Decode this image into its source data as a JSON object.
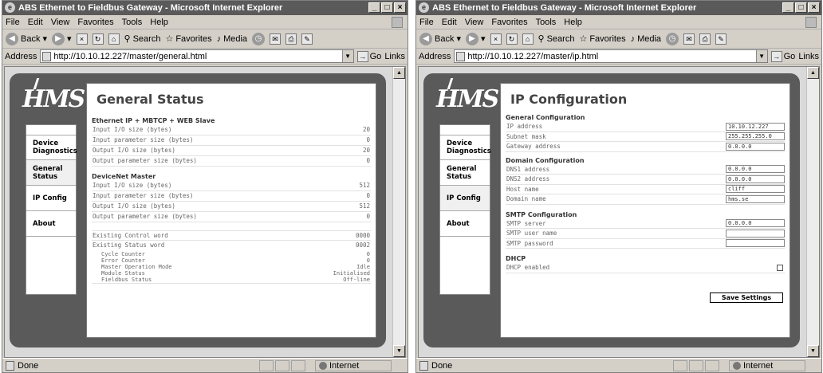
{
  "left": {
    "title": "ABS Ethernet to Fieldbus Gateway - Microsoft Internet Explorer",
    "address_label": "Address",
    "url": "http://10.10.12.227/master/general.html",
    "page_title": "General Status",
    "sections": [
      {
        "heading": "Ethernet IP + MBTCP + WEB Slave",
        "rows": [
          {
            "label": "Input I/O size (bytes)",
            "value": "20"
          },
          {
            "label": "Input parameter size (bytes)",
            "value": "0"
          },
          {
            "label": "Output I/O size (bytes)",
            "value": "20"
          },
          {
            "label": "Output parameter size (bytes)",
            "value": "0"
          }
        ]
      },
      {
        "heading": "DeviceNet Master",
        "rows": [
          {
            "label": "Input I/O size (bytes)",
            "value": "512"
          },
          {
            "label": "Input parameter size (bytes)",
            "value": "0"
          },
          {
            "label": "Output I/O size (bytes)",
            "value": "512"
          },
          {
            "label": "Output parameter size (bytes)",
            "value": "0"
          }
        ]
      }
    ],
    "control_word": {
      "label": "Existing Control word",
      "value": "0000"
    },
    "status_word": {
      "label": "Existing Status word",
      "value": "0002"
    },
    "status_sub": [
      {
        "label": "Cycle Counter",
        "value": "0"
      },
      {
        "label": "Error Counter",
        "value": "0"
      },
      {
        "label": "Master Operation Mode",
        "value": "Idle"
      },
      {
        "label": "Module Status",
        "value": "Initialised"
      },
      {
        "label": "Fieldbus Status",
        "value": "Off-line"
      }
    ]
  },
  "right": {
    "title": "ABS Ethernet to Fieldbus Gateway - Microsoft Internet Explorer",
    "address_label": "Address",
    "url": "http://10.10.12.227/master/ip.html",
    "page_title": "IP Configuration",
    "general": {
      "heading": "General Configuration",
      "rows": [
        {
          "label": "IP address",
          "value": "10.10.12.227"
        },
        {
          "label": "Subnet mask",
          "value": "255.255.255.0"
        },
        {
          "label": "Gateway address",
          "value": "0.0.0.0"
        }
      ]
    },
    "domain": {
      "heading": "Domain Configuration",
      "rows": [
        {
          "label": "DNS1 address",
          "value": "0.0.0.0"
        },
        {
          "label": "DNS2 address",
          "value": "0.0.0.0"
        },
        {
          "label": "Host name",
          "value": "cliff"
        },
        {
          "label": "Domain name",
          "value": "hms.se"
        }
      ]
    },
    "smtp": {
      "heading": "SMTP Configuration",
      "rows": [
        {
          "label": "SMTP server",
          "value": "0.0.0.0"
        },
        {
          "label": "SMTP user name",
          "value": ""
        },
        {
          "label": "SMTP password",
          "value": ""
        }
      ]
    },
    "dhcp": {
      "heading": "DHCP",
      "label": "DHCP enabled",
      "checked": false
    },
    "save_label": "Save Settings"
  },
  "menu": [
    "File",
    "Edit",
    "View",
    "Favorites",
    "Tools",
    "Help"
  ],
  "toolbar": {
    "back": "Back",
    "search": "Search",
    "favorites": "Favorites",
    "media": "Media",
    "go": "Go",
    "links": "Links"
  },
  "nav": [
    "Device Diagnostics",
    "General Status",
    "IP Config",
    "About"
  ],
  "logo": "HMS",
  "status": {
    "done": "Done",
    "zone": "Internet"
  },
  "colors": {
    "titlebar": "#5a5a5a",
    "frame": "#5a5a5a",
    "chrome": "#d4d0c8"
  }
}
